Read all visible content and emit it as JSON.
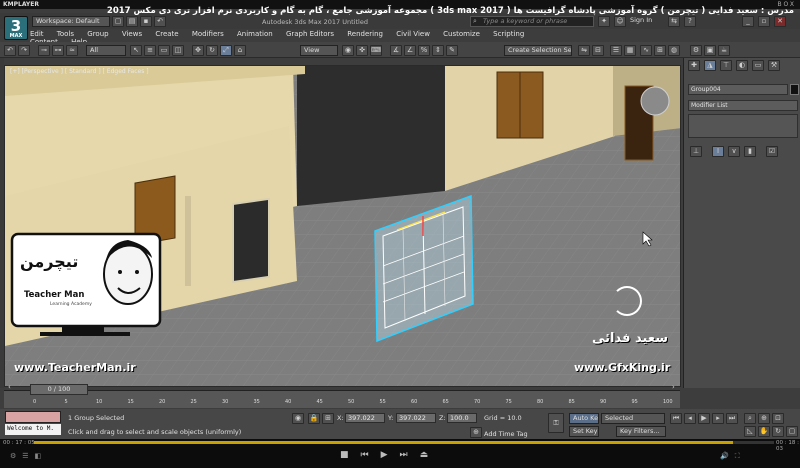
{
  "player": {
    "logo": "KMPLAYER",
    "top_right": "BOX",
    "time_elapsed": "00 : 17 : 05",
    "time_total": "00 : 18 : 03",
    "progress": 0.945
  },
  "banner": "مجموعه آموزشی جامع ، گام به گام و کاربردی نرم افزار تری دی مکس 2017  ( 3ds max 2017 )   مدرس : سعید فدایی ( تیچرمن ) گروه آموزشی پادشاه گرافیست ها",
  "max": {
    "logo": "3",
    "logo_sub": "MAX",
    "workspace": "Workspace: Default",
    "app_title": "Autodesk 3ds Max 2017      Untitled",
    "search_placeholder": "Type a keyword or phrase",
    "sign_in": "Sign In"
  },
  "menu": [
    "Edit",
    "Tools",
    "Group",
    "Views",
    "Create",
    "Modifiers",
    "Animation",
    "Graph Editors",
    "Rendering",
    "Civil View",
    "Customize",
    "Scripting",
    "Content",
    "Help"
  ],
  "toolbar": {
    "filter": "All",
    "ref_coord": "View",
    "selection_set": "Create Selection Se"
  },
  "viewport": {
    "label": "[+] [Perspective ] [ Standard ] [ Edged Faces ]"
  },
  "overlay": {
    "logo_brand": "تیچرمن",
    "logo_en": "Teacher Man",
    "logo_sub": "Learning Academy",
    "site_left": "www.TeacherMan.ir",
    "author": "سعید فدائی",
    "site_right": "www.GfxKing.ir"
  },
  "panel": {
    "object_name": "Group004",
    "modifier_list": "Modifier List"
  },
  "timeline": {
    "frame": "0 / 100",
    "ticks": [
      "0",
      "5",
      "10",
      "15",
      "20",
      "25",
      "30",
      "35",
      "40",
      "45",
      "50",
      "55",
      "60",
      "65",
      "70",
      "75",
      "80",
      "85",
      "90",
      "95",
      "100"
    ]
  },
  "status": {
    "welcome": "Welcome to M.",
    "selected": "1 Group Selected",
    "prompt": "Click and drag to select and scale objects (uniformly)",
    "x_label": "X:",
    "x_value": "397.022",
    "y_label": "Y:",
    "y_value": "397.022",
    "z_label": "Z:",
    "z_value": "100.0",
    "grid": "Grid = 10.0",
    "add_time_tag": "Add Time Tag",
    "auto_key": "Auto Key",
    "set_key": "Set Key",
    "selected_dd": "Selected",
    "key_filters": "Key Filters..."
  },
  "colors": {
    "accent": "#2a6f7a",
    "autokey_bg": "#5a6e8a",
    "window_frame": "#2fd0ff"
  }
}
